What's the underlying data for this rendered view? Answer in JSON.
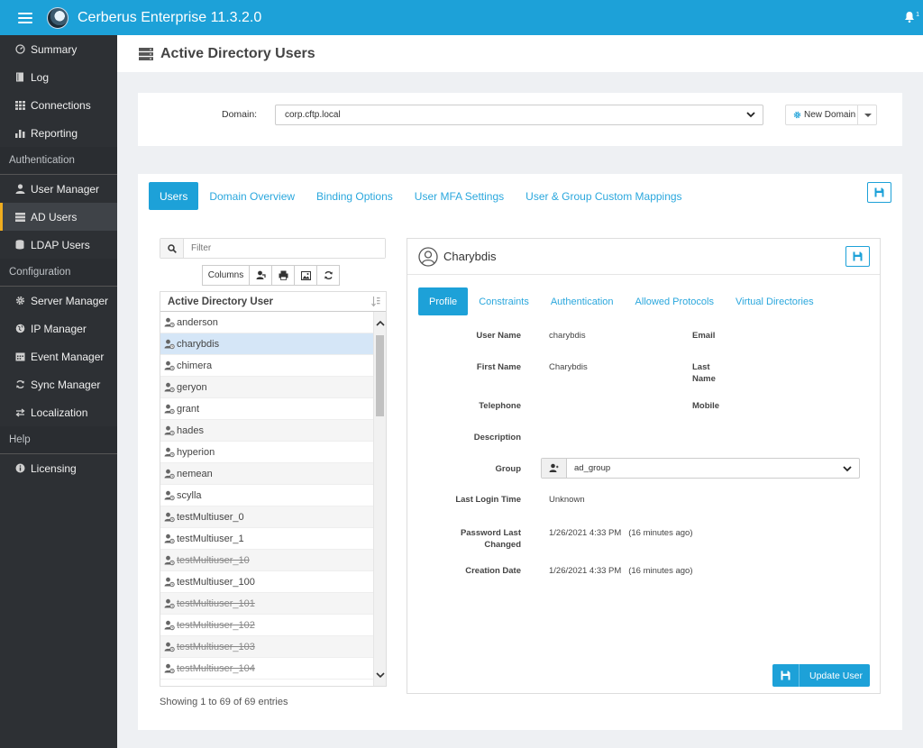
{
  "app": {
    "title": "Cerberus Enterprise 11.3.2.0",
    "notification_count": "1"
  },
  "sidebar": {
    "items": [
      {
        "label": "Summary",
        "icon": "dashboard-icon"
      },
      {
        "label": "Log",
        "icon": "book-icon"
      },
      {
        "label": "Connections",
        "icon": "grid-icon"
      },
      {
        "label": "Reporting",
        "icon": "bar-chart-icon"
      }
    ],
    "sections": [
      {
        "title": "Authentication",
        "items": [
          {
            "label": "User Manager",
            "icon": "user-icon"
          },
          {
            "label": "AD Users",
            "icon": "server-icon",
            "active": true
          },
          {
            "label": "LDAP Users",
            "icon": "database-icon"
          }
        ]
      },
      {
        "title": "Configuration",
        "items": [
          {
            "label": "Server Manager",
            "icon": "gear-icon"
          },
          {
            "label": "IP Manager",
            "icon": "globe-icon"
          },
          {
            "label": "Event Manager",
            "icon": "calendar-icon"
          },
          {
            "label": "Sync Manager",
            "icon": "sync-icon"
          },
          {
            "label": "Localization",
            "icon": "exchange-icon"
          }
        ]
      },
      {
        "title": "Help",
        "items": [
          {
            "label": "Licensing",
            "icon": "info-icon"
          }
        ]
      }
    ]
  },
  "page": {
    "title": "Active Directory Users"
  },
  "domain": {
    "label": "Domain:",
    "value": "corp.cftp.local",
    "new_domain_label": "New Domain"
  },
  "tabs": [
    "Users",
    "Domain Overview",
    "Binding Options",
    "User MFA Settings",
    "User & Group Custom Mappings"
  ],
  "list": {
    "filter_placeholder": "Filter",
    "columns_label": "Columns",
    "header": "Active Directory User",
    "rows": [
      {
        "name": "anderson",
        "disabled": false
      },
      {
        "name": "charybdis",
        "disabled": false,
        "selected": true
      },
      {
        "name": "chimera",
        "disabled": false
      },
      {
        "name": "geryon",
        "disabled": false
      },
      {
        "name": "grant",
        "disabled": false
      },
      {
        "name": "hades",
        "disabled": false
      },
      {
        "name": "hyperion",
        "disabled": false
      },
      {
        "name": "nemean",
        "disabled": false
      },
      {
        "name": "scylla",
        "disabled": false
      },
      {
        "name": "testMultiuser_0",
        "disabled": false
      },
      {
        "name": "testMultiuser_1",
        "disabled": false
      },
      {
        "name": "testMultiuser_10",
        "disabled": true
      },
      {
        "name": "testMultiuser_100",
        "disabled": false
      },
      {
        "name": "testMultiuser_101",
        "disabled": true
      },
      {
        "name": "testMultiuser_102",
        "disabled": true
      },
      {
        "name": "testMultiuser_103",
        "disabled": true
      },
      {
        "name": "testMultiuser_104",
        "disabled": true
      }
    ],
    "showing": "Showing 1 to 69 of 69 entries"
  },
  "details": {
    "name": "Charybdis",
    "tabs": [
      "Profile",
      "Constraints",
      "Authentication",
      "Allowed Protocols",
      "Virtual Directories"
    ],
    "fields": {
      "user_name_label": "User Name",
      "user_name": "charybdis",
      "email_label": "Email",
      "first_name_label": "First Name",
      "first_name": "Charybdis",
      "last_name_label_1": "Last",
      "last_name_label_2": "Name",
      "telephone_label": "Telephone",
      "mobile_label": "Mobile",
      "description_label": "Description",
      "group_label": "Group",
      "group": "ad_group",
      "last_login_label": "Last Login Time",
      "last_login": "Unknown",
      "password_changed_label_1": "Password Last",
      "password_changed_label_2": "Changed",
      "password_changed": "1/26/2021 4:33 PM   (16 minutes ago)",
      "creation_date_label": "Creation Date",
      "creation_date": "1/26/2021 4:33 PM   (16 minutes ago)"
    },
    "update_label": "Update User"
  },
  "colors": {
    "accent": "#1da1d8",
    "sidebar": "#2d3034",
    "active_marker": "#f0ad1f"
  }
}
